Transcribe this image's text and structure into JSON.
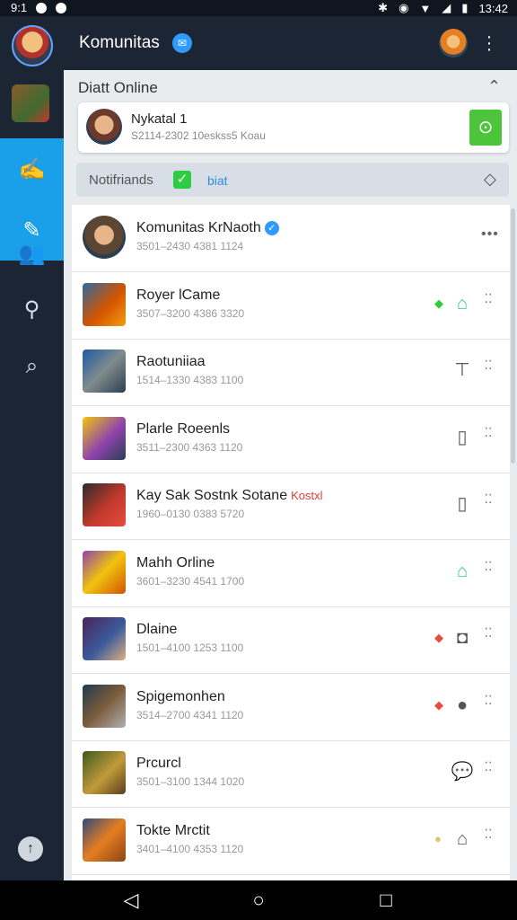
{
  "status_bar": {
    "left_text": "9:1",
    "right_text": "13:42"
  },
  "header": {
    "title": "Komunitas"
  },
  "online_section": {
    "header": "Diatt Online",
    "card": {
      "name": "Nykatal 1",
      "subtitle": "S2114-2302 10eskss5 Koau"
    }
  },
  "notif_bar": {
    "label": "Notifriands",
    "link": "biat"
  },
  "rows": [
    {
      "title": "Komunitas KrNaoth",
      "subtitle": "3501‒2430 4381 1124",
      "verified": true,
      "action": "more",
      "thumb": "game-avatar-1"
    },
    {
      "title": "Royer lCame",
      "subtitle": "3507‒3200 4386 3320",
      "action": "home-icon",
      "accent": "#2ecc40",
      "thumb": "game-avatar-2"
    },
    {
      "title": "Raotuniiaa",
      "subtitle": "1514‒1330 4383 1100",
      "action": "desk-icon",
      "thumb": "game-avatar-3"
    },
    {
      "title": "Plarle Roeenls",
      "subtitle": "3511‒2300 4363 1120",
      "action": "doc-icon",
      "thumb": "game-avatar-4"
    },
    {
      "title": "Kay Sak Sostnk Sotane",
      "tag": "Kostxl",
      "subtitle": "1960‒0130 0383 5720",
      "action": "doc-icon",
      "thumb": "game-avatar-5"
    },
    {
      "title": "Mahh Orline",
      "subtitle": "3601‒3230 4541 1700",
      "action": "home-icon",
      "thumb": "game-avatar-6"
    },
    {
      "title": "Dlaine",
      "subtitle": "1501‒4100 1253 1100",
      "action": "camera-icon",
      "accent": "#e74c3c",
      "thumb": "game-avatar-7"
    },
    {
      "title": "Spigemonhen",
      "subtitle": "3514‒2700 4341 1120",
      "action": "avatar-icon",
      "accent": "#e74c3c",
      "thumb": "game-avatar-8"
    },
    {
      "title": "Prcurcl",
      "subtitle": "3501‒3100 1344 1020",
      "action": "chat-icon",
      "thumb": "game-avatar-9"
    },
    {
      "title": "Tokte Mrctit",
      "subtitle": "3401‒4100 4353 1120",
      "action": "basket-icon",
      "accent": "#e6c36a",
      "thumb": "game-avatar-10"
    }
  ],
  "colors": {
    "accent_blue": "#1aa0e8",
    "sidebar_bg": "#1c2533",
    "green": "#4cc53d"
  }
}
